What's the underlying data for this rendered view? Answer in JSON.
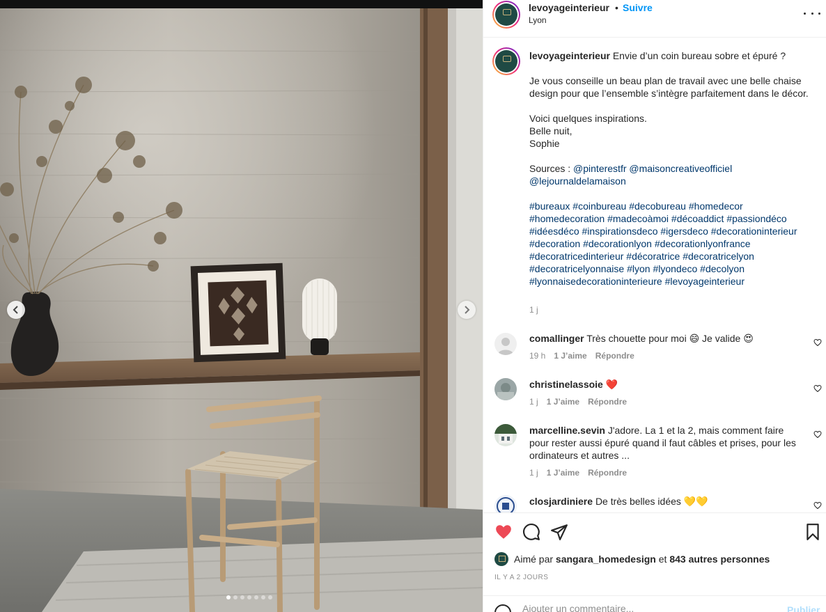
{
  "post": {
    "username": "levoyageinterieur",
    "separator": "•",
    "follow_label": "Suivre",
    "location": "Lyon"
  },
  "caption": {
    "username": "levoyageinterieur",
    "line1": "Envie d’un coin bureau sobre et épuré ?",
    "para2": "Je vous conseille un beau plan de travail avec une belle chaise design pour que l’ensemble s’intègre parfaitement dans le décor.",
    "line_voici": "Voici quelques inspirations.",
    "line_belle": "Belle nuit,",
    "line_sophie": "Sophie",
    "sources_label": "Sources :",
    "source_1": "@pinterestfr",
    "source_2": "@maisoncreativeofficiel",
    "source_3": "@lejournaldelamaison",
    "hashtags": [
      "#bureaux",
      "#coinbureau",
      "#decobureau",
      "#homedecor",
      "#homedecoration",
      "#madecoàmoi",
      "#décoaddict",
      "#passiondéco",
      "#idéesdéco",
      "#inspirationsdeco",
      "#igersdeco",
      "#decorationinterieur",
      "#decoration",
      "#decorationlyon",
      "#decorationlyonfrance",
      "#decoratricedinterieur",
      "#décoratrice",
      "#decoratricelyon",
      "#decoratricelyonnaise",
      "#lyon",
      "#lyondeco",
      "#decolyon",
      "#lyonnaisedecorationinterieure",
      "#levoyageinterieur"
    ],
    "time": "1 j"
  },
  "comments": [
    {
      "username": "comallinger",
      "text": "Très chouette pour moi 😄 Je valide 😍",
      "time": "19 h",
      "likes": "1 J’aime",
      "reply": "Répondre"
    },
    {
      "username": "christinelassoie",
      "text": "❤️",
      "time": "1 j",
      "likes": "1 J’aime",
      "reply": "Répondre"
    },
    {
      "username": "marcelline.sevin",
      "text": "J'adore. La 1 et la 2, mais comment faire pour rester aussi épuré quand il faut câbles et prises, pour les ordinateurs et autres ...",
      "time": "1 j",
      "likes": "1 J’aime",
      "reply": "Répondre"
    },
    {
      "username": "closjardiniere",
      "text": "De très belles idées 💛💛",
      "time": "",
      "likes": "",
      "reply": ""
    }
  ],
  "likes": {
    "prefix": "Aimé par",
    "user": "sangara_homedesign",
    "and": "et",
    "others": "843 autres personnes"
  },
  "date": "IL Y A 2 JOURS",
  "add_comment": {
    "placeholder": "Ajouter un commentaire...",
    "publish": "Publier"
  },
  "carousel": {
    "count": 7,
    "active_index": 0
  },
  "icons": {
    "like": "heart-filled-icon",
    "comment": "comment-bubble-icon",
    "share": "paper-plane-icon",
    "save": "bookmark-icon",
    "more": "ellipsis-icon",
    "prev": "chevron-left-icon",
    "next": "chevron-right-icon"
  },
  "colors": {
    "link": "#00376b",
    "follow": "#0095f6",
    "like_red": "#ed4956",
    "muted": "#8e8e8e"
  }
}
